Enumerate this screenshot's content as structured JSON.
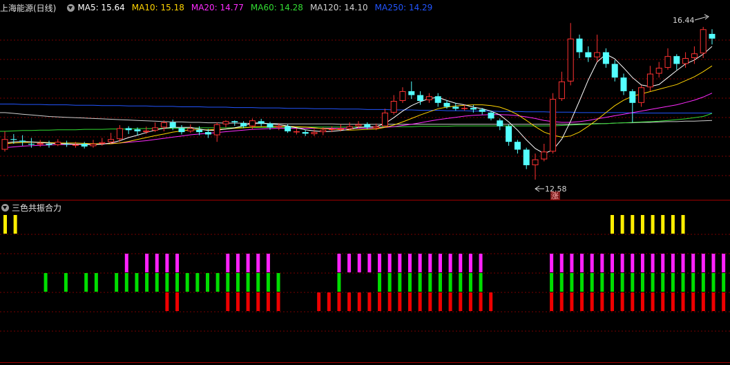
{
  "main_panel": {
    "stock_title": "上海能源(日线)",
    "ma_labels": [
      {
        "label": "MA5: 15.64",
        "color": "#ffffff"
      },
      {
        "label": "MA10: 15.18",
        "color": "#ffd400"
      },
      {
        "label": "MA20: 14.77",
        "color": "#ff2bff"
      },
      {
        "label": "MA60: 14.28",
        "color": "#33dd33"
      },
      {
        "label": "MA120: 14.10",
        "color": "#d0d0d0"
      },
      {
        "label": "MA250: 14.29",
        "color": "#2255ff"
      }
    ],
    "high_label": "16.44",
    "low_label": "12.58",
    "event_marker": "涨"
  },
  "indicator_panel": {
    "title": "三色共振合力"
  },
  "colors": {
    "up": "#ff3232",
    "down": "#54ffff",
    "grid": "#7a0000",
    "yellow": "#ffee00",
    "magenta": "#ff22ff",
    "green": "#00dd00",
    "red": "#ee0000"
  },
  "chart_data": {
    "type": "candlestick",
    "price_range": [
      12.4,
      16.8
    ],
    "candles": [
      [
        13.35,
        13.62,
        13.82,
        13.3
      ],
      [
        13.62,
        13.6,
        13.75,
        13.5
      ],
      [
        13.58,
        13.55,
        13.72,
        13.45
      ],
      [
        13.5,
        13.48,
        13.65,
        13.4
      ],
      [
        13.48,
        13.52,
        13.6,
        13.42
      ],
      [
        13.5,
        13.47,
        13.58,
        13.4
      ],
      [
        13.47,
        13.55,
        13.62,
        13.44
      ],
      [
        13.5,
        13.48,
        13.58,
        13.42
      ],
      [
        13.45,
        13.48,
        13.55,
        13.4
      ],
      [
        13.5,
        13.43,
        13.55,
        13.38
      ],
      [
        13.44,
        13.5,
        13.6,
        13.4
      ],
      [
        13.5,
        13.54,
        13.65,
        13.45
      ],
      [
        13.54,
        13.62,
        13.78,
        13.5
      ],
      [
        13.62,
        13.9,
        13.98,
        13.55
      ],
      [
        13.9,
        13.85,
        13.95,
        13.75
      ],
      [
        13.87,
        13.82,
        13.92,
        13.72
      ],
      [
        13.8,
        13.84,
        13.94,
        13.75
      ],
      [
        13.84,
        13.92,
        14.05,
        13.8
      ],
      [
        13.92,
        14.05,
        14.1,
        13.82
      ],
      [
        14.05,
        13.92,
        14.12,
        13.85
      ],
      [
        13.9,
        13.8,
        13.98,
        13.74
      ],
      [
        13.82,
        13.9,
        14.0,
        13.78
      ],
      [
        13.86,
        13.8,
        13.95,
        13.72
      ],
      [
        13.8,
        13.74,
        13.88,
        13.65
      ],
      [
        13.72,
        14.0,
        14.05,
        13.55
      ],
      [
        14.0,
        14.08,
        14.1,
        13.92
      ],
      [
        14.08,
        14.05,
        14.1,
        13.96
      ],
      [
        14.03,
        13.95,
        14.08,
        13.9
      ],
      [
        13.95,
        14.1,
        14.15,
        13.88
      ],
      [
        14.08,
        14.02,
        14.14,
        13.95
      ],
      [
        14.02,
        13.92,
        14.06,
        13.86
      ],
      [
        13.92,
        13.96,
        14.02,
        13.85
      ],
      [
        13.95,
        13.82,
        14.0,
        13.78
      ],
      [
        13.8,
        13.82,
        13.9,
        13.74
      ],
      [
        13.8,
        13.76,
        13.86,
        13.7
      ],
      [
        13.75,
        13.8,
        13.88,
        13.7
      ],
      [
        13.8,
        13.86,
        13.92,
        13.72
      ],
      [
        13.86,
        13.88,
        13.95,
        13.8
      ],
      [
        13.86,
        13.9,
        14.0,
        13.82
      ],
      [
        13.88,
        13.95,
        14.05,
        13.84
      ],
      [
        13.95,
        14.0,
        14.08,
        13.9
      ],
      [
        14.0,
        13.92,
        14.05,
        13.88
      ],
      [
        13.9,
        13.95,
        14.02,
        13.85
      ],
      [
        13.95,
        14.3,
        14.4,
        13.92
      ],
      [
        14.3,
        14.6,
        14.75,
        14.25
      ],
      [
        14.6,
        14.85,
        14.95,
        14.55
      ],
      [
        14.85,
        14.75,
        15.1,
        14.65
      ],
      [
        14.75,
        14.6,
        14.85,
        14.5
      ],
      [
        14.62,
        14.72,
        14.8,
        14.55
      ],
      [
        14.72,
        14.55,
        14.8,
        14.45
      ],
      [
        14.55,
        14.45,
        14.62,
        14.4
      ],
      [
        14.45,
        14.4,
        14.55,
        14.35
      ],
      [
        14.4,
        14.42,
        14.5,
        14.35
      ],
      [
        14.42,
        14.38,
        14.5,
        14.3
      ],
      [
        14.38,
        14.32,
        14.42,
        14.25
      ],
      [
        14.3,
        14.15,
        14.35,
        14.1
      ],
      [
        14.1,
        13.95,
        14.15,
        13.85
      ],
      [
        13.95,
        13.55,
        14.0,
        13.45
      ],
      [
        13.55,
        13.35,
        13.6,
        13.25
      ],
      [
        13.35,
        12.95,
        13.4,
        12.85
      ],
      [
        12.95,
        13.1,
        13.25,
        12.58
      ],
      [
        13.1,
        13.3,
        13.5,
        13.05
      ],
      [
        13.3,
        14.65,
        14.8,
        13.25
      ],
      [
        14.65,
        15.1,
        15.35,
        14.6
      ],
      [
        15.1,
        16.2,
        16.6,
        15.0
      ],
      [
        16.2,
        15.85,
        16.3,
        15.7
      ],
      [
        15.85,
        15.72,
        16.0,
        15.6
      ],
      [
        15.72,
        15.85,
        16.3,
        15.6
      ],
      [
        15.85,
        15.55,
        15.95,
        15.45
      ],
      [
        15.55,
        15.2,
        15.65,
        15.1
      ],
      [
        15.2,
        14.85,
        15.3,
        14.75
      ],
      [
        14.85,
        14.55,
        14.9,
        14.05
      ],
      [
        14.55,
        14.95,
        15.0,
        14.45
      ],
      [
        14.95,
        15.3,
        15.5,
        14.85
      ],
      [
        15.3,
        15.45,
        15.6,
        15.2
      ],
      [
        15.45,
        15.75,
        15.95,
        15.4
      ],
      [
        15.75,
        15.55,
        15.8,
        15.4
      ],
      [
        15.55,
        15.7,
        15.85,
        15.45
      ],
      [
        15.7,
        15.82,
        16.0,
        15.55
      ],
      [
        15.82,
        16.44,
        16.5,
        15.7
      ],
      [
        16.32,
        16.2,
        16.44,
        16.05
      ]
    ],
    "ma5": [
      13.52,
      13.55,
      13.56,
      13.55,
      13.53,
      13.52,
      13.5,
      13.5,
      13.49,
      13.48,
      13.48,
      13.49,
      13.52,
      13.58,
      13.66,
      13.72,
      13.79,
      13.85,
      13.9,
      13.92,
      13.92,
      13.92,
      13.88,
      13.84,
      13.85,
      13.88,
      13.91,
      13.96,
      14.03,
      14.04,
      14.01,
      13.99,
      13.96,
      13.91,
      13.86,
      13.83,
      13.81,
      13.82,
      13.84,
      13.87,
      13.92,
      13.93,
      13.94,
      14.02,
      14.17,
      14.34,
      14.48,
      14.58,
      14.66,
      14.69,
      14.61,
      14.54,
      14.5,
      14.44,
      14.4,
      14.34,
      14.24,
      14.06,
      13.85,
      13.6,
      13.38,
      13.25,
      13.34,
      13.62,
      14.08,
      14.6,
      15.14,
      15.6,
      15.8,
      15.68,
      15.45,
      15.2,
      15.01,
      14.97,
      15.02,
      15.2,
      15.38,
      15.55,
      15.65,
      15.8,
      16.0
    ],
    "ma10": [
      13.5,
      13.52,
      13.53,
      13.54,
      13.54,
      13.53,
      13.52,
      13.52,
      13.52,
      13.51,
      13.5,
      13.5,
      13.5,
      13.52,
      13.56,
      13.61,
      13.66,
      13.71,
      13.75,
      13.8,
      13.83,
      13.86,
      13.86,
      13.86,
      13.87,
      13.88,
      13.9,
      13.91,
      13.93,
      13.94,
      13.94,
      13.95,
      13.95,
      13.94,
      13.93,
      13.91,
      13.89,
      13.88,
      13.86,
      13.85,
      13.86,
      13.87,
      13.88,
      13.92,
      13.98,
      14.06,
      14.15,
      14.24,
      14.32,
      14.4,
      14.44,
      14.47,
      14.49,
      14.5,
      14.5,
      14.48,
      14.44,
      14.36,
      14.25,
      14.1,
      13.94,
      13.8,
      13.72,
      13.67,
      13.7,
      13.8,
      13.95,
      14.12,
      14.3,
      14.48,
      14.62,
      14.72,
      14.78,
      14.84,
      14.9,
      14.96,
      15.02,
      15.12,
      15.22,
      15.35,
      15.5
    ],
    "ma20": [
      13.4,
      13.42,
      13.44,
      13.45,
      13.46,
      13.47,
      13.48,
      13.48,
      13.49,
      13.49,
      13.5,
      13.5,
      13.51,
      13.52,
      13.54,
      13.56,
      13.58,
      13.61,
      13.64,
      13.67,
      13.7,
      13.73,
      13.75,
      13.77,
      13.79,
      13.81,
      13.83,
      13.85,
      13.87,
      13.88,
      13.89,
      13.9,
      13.9,
      13.9,
      13.9,
      13.9,
      13.9,
      13.9,
      13.9,
      13.9,
      13.9,
      13.9,
      13.91,
      13.92,
      13.94,
      13.97,
      14.0,
      14.04,
      14.08,
      14.12,
      14.15,
      14.18,
      14.21,
      14.23,
      14.24,
      14.25,
      14.25,
      14.24,
      14.22,
      14.19,
      14.15,
      14.1,
      14.07,
      14.05,
      14.05,
      14.07,
      14.1,
      14.14,
      14.18,
      14.22,
      14.26,
      14.3,
      14.34,
      14.38,
      14.42,
      14.46,
      14.5,
      14.56,
      14.62,
      14.7,
      14.8
    ],
    "ma60": [
      13.82,
      13.83,
      13.84,
      13.84,
      13.85,
      13.85,
      13.86,
      13.86,
      13.86,
      13.87,
      13.87,
      13.87,
      13.88,
      13.88,
      13.88,
      13.89,
      13.89,
      13.89,
      13.9,
      13.9,
      13.9,
      13.9,
      13.91,
      13.91,
      13.91,
      13.91,
      13.91,
      13.92,
      13.92,
      13.92,
      13.92,
      13.92,
      13.92,
      13.92,
      13.93,
      13.93,
      13.93,
      13.93,
      13.93,
      13.93,
      13.93,
      13.93,
      13.93,
      13.94,
      13.94,
      13.94,
      13.94,
      13.95,
      13.95,
      13.95,
      13.95,
      13.96,
      13.96,
      13.96,
      13.96,
      13.96,
      13.96,
      13.96,
      13.96,
      13.96,
      13.96,
      13.96,
      13.96,
      13.97,
      13.98,
      13.99,
      14.0,
      14.01,
      14.02,
      14.03,
      14.04,
      14.05,
      14.06,
      14.07,
      14.08,
      14.1,
      14.12,
      14.14,
      14.17,
      14.2,
      14.28
    ],
    "ma120": [
      14.3,
      14.28,
      14.26,
      14.24,
      14.22,
      14.2,
      14.19,
      14.18,
      14.17,
      14.16,
      14.15,
      14.14,
      14.13,
      14.12,
      14.11,
      14.1,
      14.09,
      14.08,
      14.07,
      14.06,
      14.06,
      14.05,
      14.05,
      14.04,
      14.04,
      14.03,
      14.03,
      14.03,
      14.02,
      14.02,
      14.02,
      14.02,
      14.01,
      14.01,
      14.01,
      14.01,
      14.01,
      14.01,
      14.0,
      14.0,
      14.0,
      14.0,
      14.0,
      14.0,
      14.0,
      14.0,
      14.0,
      14.0,
      14.0,
      14.0,
      14.0,
      14.0,
      14.0,
      14.0,
      14.0,
      14.0,
      14.0,
      14.0,
      14.0,
      14.0,
      14.0,
      14.0,
      14.0,
      14.0,
      14.0,
      14.01,
      14.01,
      14.02,
      14.02,
      14.03,
      14.04,
      14.04,
      14.05,
      14.05,
      14.06,
      14.07,
      14.07,
      14.08,
      14.08,
      14.09,
      14.1
    ],
    "ma250": [
      14.52,
      14.52,
      14.51,
      14.51,
      14.51,
      14.5,
      14.5,
      14.5,
      14.49,
      14.49,
      14.49,
      14.48,
      14.48,
      14.48,
      14.47,
      14.47,
      14.47,
      14.46,
      14.46,
      14.46,
      14.45,
      14.45,
      14.45,
      14.44,
      14.44,
      14.44,
      14.43,
      14.43,
      14.43,
      14.42,
      14.42,
      14.42,
      14.41,
      14.41,
      14.41,
      14.4,
      14.4,
      14.4,
      14.39,
      14.39,
      14.39,
      14.38,
      14.38,
      14.38,
      14.37,
      14.37,
      14.37,
      14.36,
      14.36,
      14.36,
      14.35,
      14.35,
      14.35,
      14.34,
      14.34,
      14.34,
      14.33,
      14.33,
      14.33,
      14.32,
      14.32,
      14.32,
      14.31,
      14.31,
      14.31,
      14.3,
      14.3,
      14.3,
      14.3,
      14.3,
      14.3,
      14.29,
      14.29,
      14.29,
      14.29,
      14.29,
      14.29,
      14.29,
      14.29,
      14.29,
      14.29
    ],
    "yellow_bars": [
      0,
      1,
      60,
      61,
      62,
      63,
      64,
      65,
      66,
      67
    ],
    "magenta_bars": [
      12,
      14,
      15,
      16,
      17,
      22,
      23,
      24,
      25,
      26,
      33,
      34,
      35,
      36,
      37,
      38,
      39,
      40,
      41,
      42,
      43,
      44,
      45,
      46,
      47,
      54,
      55,
      56,
      57,
      58,
      59,
      60,
      61,
      62,
      63,
      64,
      65,
      66,
      67,
      68,
      69,
      70,
      71
    ],
    "green_bars": [
      4,
      6,
      8,
      9,
      11,
      12,
      13,
      14,
      15,
      16,
      17,
      18,
      19,
      20,
      21,
      22,
      23,
      24,
      25,
      26,
      27,
      33,
      37,
      38,
      39,
      40,
      41,
      42,
      43,
      44,
      45,
      46,
      47,
      54,
      55,
      56,
      57,
      58,
      59,
      60,
      61,
      62,
      63,
      64,
      65,
      66,
      67,
      68,
      69,
      70,
      71
    ],
    "red_bars": [
      16,
      17,
      22,
      23,
      24,
      25,
      26,
      27,
      31,
      32,
      33,
      34,
      35,
      36,
      37,
      38,
      39,
      40,
      41,
      42,
      43,
      44,
      45,
      46,
      47,
      48,
      54,
      55,
      56,
      57,
      58,
      59,
      60,
      61,
      62,
      63,
      64,
      65,
      66,
      67,
      68,
      69,
      70,
      71
    ]
  }
}
